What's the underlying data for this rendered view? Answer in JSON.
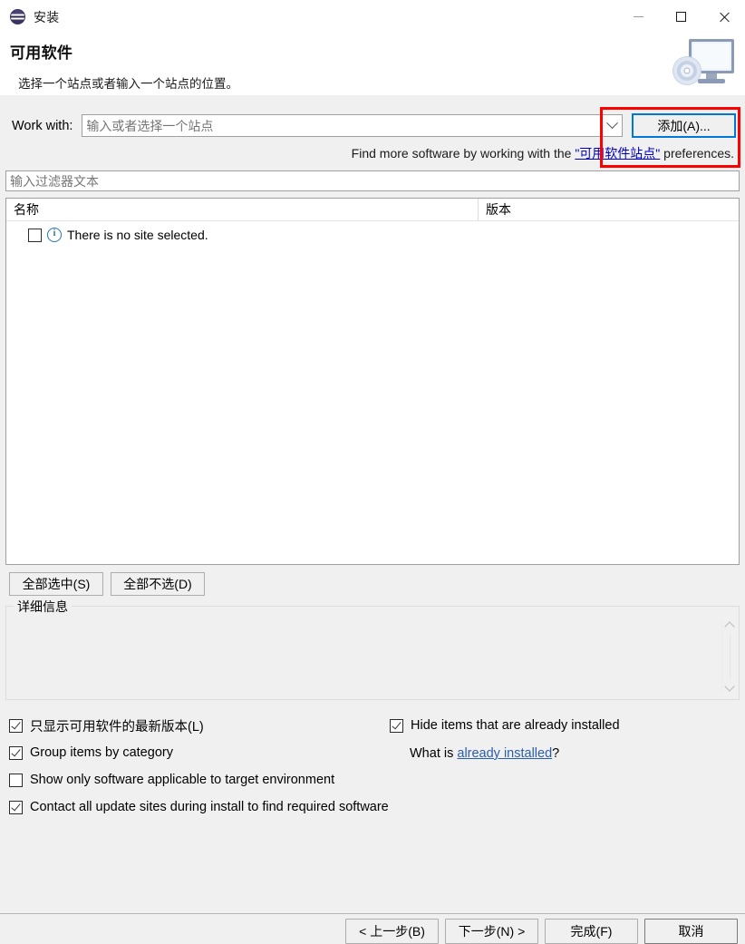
{
  "window": {
    "title": "安装",
    "icon": "eclipse-logo-icon",
    "controls": {
      "minimize": "minimize-icon",
      "maximize": "maximize-icon",
      "close": "close-icon"
    }
  },
  "banner": {
    "title": "可用软件",
    "subtitle": "选择一个站点或者输入一个站点的位置。",
    "icon": "monitor-disc-icon"
  },
  "work_with": {
    "label": "Work with:",
    "value": "",
    "placeholder": "输入或者选择一个站点",
    "dropdown_icon": "chevron-down-icon",
    "add_button": "添加(A)..."
  },
  "hint": {
    "prefix": "Find more software by working with the ",
    "link": "\"可用软件站点\"",
    "suffix": " preferences."
  },
  "filter": {
    "value": "",
    "placeholder": "输入过滤器文本"
  },
  "table": {
    "columns": [
      "名称",
      "版本"
    ],
    "rows": [
      {
        "checked": false,
        "icon": "info-icon",
        "name": "There is no site selected.",
        "version": ""
      }
    ]
  },
  "selection_buttons": {
    "select_all": "全部选中(S)",
    "deselect_all": "全部不选(D)"
  },
  "details": {
    "legend": "详细信息",
    "text": "",
    "scroll_up_icon": "chevron-up-icon",
    "scroll_down_icon": "chevron-down-icon"
  },
  "options": {
    "left": [
      {
        "label": "只显示可用软件的最新版本(L)",
        "checked": true
      },
      {
        "label": "Group items by category",
        "checked": true
      },
      {
        "label": "Show only software applicable to target environment",
        "checked": false
      },
      {
        "label": "Contact all update sites during install to find required software",
        "checked": true
      }
    ],
    "right": {
      "hide_installed": {
        "label": "Hide items that are already installed",
        "checked": true
      },
      "whatis_prefix": "What is ",
      "whatis_link": "already installed",
      "whatis_suffix": "?"
    }
  },
  "footer": {
    "back": "< 上一步(B)",
    "next": "下一步(N) >",
    "finish": "完成(F)",
    "cancel": "取消"
  },
  "annotation": {
    "color": "#ff0000",
    "target": "添加(A)..."
  }
}
